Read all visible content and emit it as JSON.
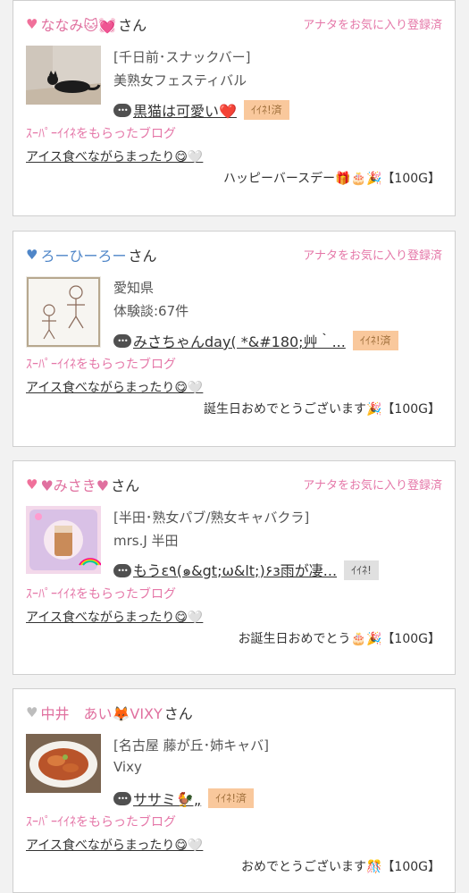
{
  "colors": {
    "accent_pink": "#e577a8",
    "badge_orange": "#f9c89c",
    "badge_gray": "#e0e0e0",
    "heart_blue": "#4f86c8",
    "heart_gray": "#bdbdbd"
  },
  "cards": [
    {
      "heart_icon": "pink-heart-icon",
      "heart_glyph": "♥",
      "name": "ななみ🐱💓",
      "honorific": "さん",
      "fav_status": "アナタをお気に入り登録済",
      "meta1": "[千日前･スナックバー]",
      "meta2": "美熟女フェスティバル",
      "blog_title": "黒猫は可愛い❤️",
      "iine_label": "ｲｲﾈ!済",
      "super_label": "ｽｰﾊﾟｰｲｲﾈをもらったブログ",
      "super_blog_title": "アイス食べながらまったり😋🤍",
      "message": "ハッピーバースデー🎁🎂🎉【100G】"
    },
    {
      "heart_icon": "blue-heart-icon",
      "heart_glyph": "♥",
      "name": "ろーひーろー",
      "honorific": "さん",
      "fav_status": "アナタをお気に入り登録済",
      "meta1": "愛知県",
      "meta2": "体験談:67件",
      "blog_title": "みさちゃんday( *&#180;艸｀...",
      "iine_label": "ｲｲﾈ!済",
      "super_label": "ｽｰﾊﾟｰｲｲﾈをもらったブログ",
      "super_blog_title": "アイス食べながらまったり😋🤍",
      "message": "誕生日おめでとうございます🎉【100G】"
    },
    {
      "heart_icon": "pink-heart-icon",
      "heart_glyph": "♥",
      "name": "♥みさき♥",
      "honorific": "さん",
      "fav_status": "アナタをお気に入り登録済",
      "meta1": "[半田･熟女パブ/熟女キャバクラ]",
      "meta2": "mrs.J 半田",
      "blog_title": "もうε٩(๑&gt;ω&lt;)۶з雨が凄...",
      "iine_label": "ｲｲﾈ!",
      "super_label": "ｽｰﾊﾟｰｲｲﾈをもらったブログ",
      "super_blog_title": "アイス食べながらまったり😋🤍",
      "message": "お誕生日おめでとう🎂🎉【100G】"
    },
    {
      "heart_icon": "gray-heart-icon",
      "heart_glyph": "♥",
      "name": "中井　あい🦊VIXY",
      "honorific": "さん",
      "fav_status": "",
      "meta1": "[名古屋 藤が丘･姉キャバ]",
      "meta2": "Vixy",
      "blog_title": "ササミ🐓„",
      "iine_label": "ｲｲﾈ!済",
      "super_label": "ｽｰﾊﾟｰｲｲﾈをもらったブログ",
      "super_blog_title": "アイス食べながらまったり😋🤍",
      "message": "おめでとうございます🎊【100G】"
    }
  ]
}
